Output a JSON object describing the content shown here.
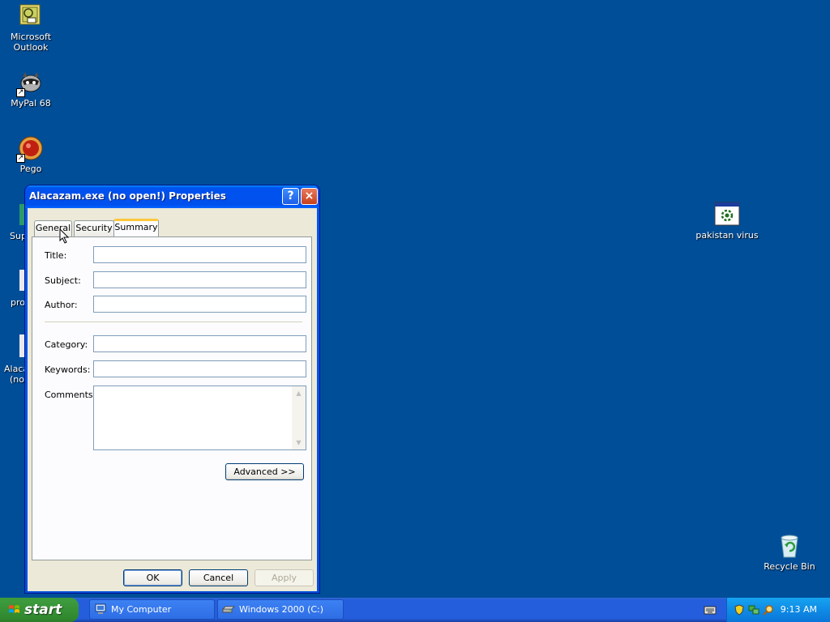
{
  "desktop": {
    "icons": [
      {
        "label_line1": "Microsoft",
        "label_line2": "Outlook"
      },
      {
        "label_line1": "MyPal 68",
        "label_line2": ""
      },
      {
        "label_line1": "Pego",
        "label_line2": ""
      },
      {
        "label_line1": "pakistan virus",
        "label_line2": ""
      },
      {
        "label_line1": "Recycle Bin",
        "label_line2": ""
      }
    ],
    "partial_labels": [
      "Sup",
      "pro",
      "Alaca",
      "(no"
    ]
  },
  "window": {
    "title": "Alacazam.exe (no open!) Properties",
    "help_label": "?",
    "close_label": "×",
    "tabs": [
      {
        "label": "General",
        "active": false
      },
      {
        "label": "Security",
        "active": false
      },
      {
        "label": "Summary",
        "active": true
      }
    ],
    "fields": [
      {
        "label": "Title:",
        "value": ""
      },
      {
        "label": "Subject:",
        "value": ""
      },
      {
        "label": "Author:",
        "value": ""
      },
      {
        "label": "Category:",
        "value": ""
      },
      {
        "label": "Keywords:",
        "value": ""
      },
      {
        "label": "Comments:",
        "value": ""
      }
    ],
    "advanced_label": "Advanced >>",
    "ok_label": "OK",
    "cancel_label": "Cancel",
    "apply_label": "Apply"
  },
  "taskbar": {
    "start_label": "start",
    "tasks": [
      {
        "label": "My Computer",
        "icon": "my-computer-icon"
      },
      {
        "label": "Windows 2000 (C:)",
        "icon": "drive-icon"
      }
    ],
    "clock": "9:13 AM"
  },
  "colors": {
    "desktop": "#004E98",
    "titlebar": "#0053EE",
    "dialog": "#ECE9D8",
    "taskbar": "#245EDC",
    "start": "#3D9A3D"
  }
}
